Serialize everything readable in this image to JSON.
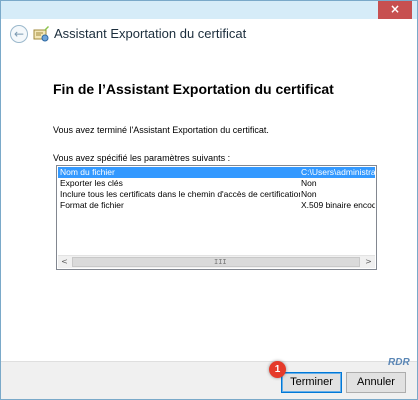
{
  "window": {
    "close_glyph": "×"
  },
  "header": {
    "title": "Assistant Exportation du certificat",
    "back_glyph": "←"
  },
  "main": {
    "page_title": "Fin de l’Assistant Exportation du certificat",
    "completed_text": "Vous avez terminé l'Assistant Exportation du certificat.",
    "specified_text": "Vous avez spécifié les paramètres suivants :",
    "settings": [
      {
        "name": "Nom du fichier",
        "value": "C:\\Users\\administra",
        "selected": true
      },
      {
        "name": "Exporter les clés",
        "value": "Non",
        "selected": false
      },
      {
        "name": "Inclure tous les certificats dans le chemin d'accès de certification",
        "value": "Non",
        "selected": false
      },
      {
        "name": "Format de fichier",
        "value": "X.509 binaire encod",
        "selected": false
      }
    ],
    "scroll": {
      "left_glyph": "<",
      "right_glyph": ">",
      "grip": "III"
    }
  },
  "footer": {
    "finish_label": "Terminer",
    "cancel_label": "Annuler",
    "badge_number": "1"
  },
  "watermark": {
    "text": "RDR"
  },
  "colors": {
    "selection": "#3399ff",
    "badge": "#e53a2a",
    "close_button": "#c75050"
  }
}
